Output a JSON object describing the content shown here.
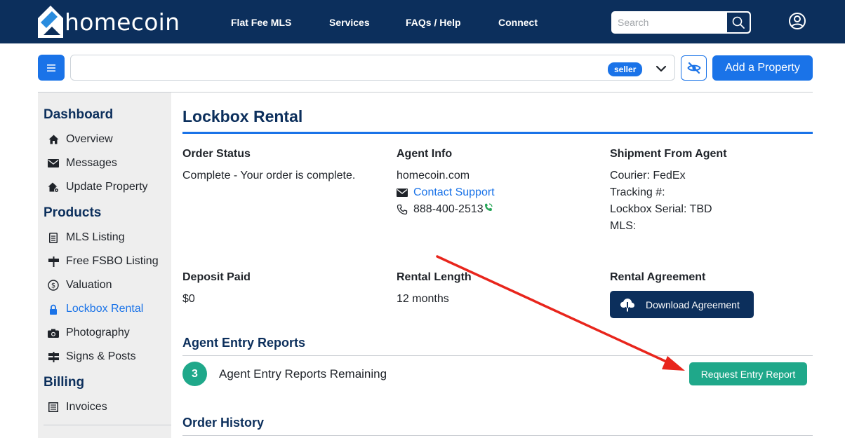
{
  "brand": {
    "name": "homecoin"
  },
  "nav": {
    "links": [
      "Flat Fee MLS",
      "Services",
      "FAQs / Help",
      "Connect"
    ],
    "search_placeholder": "Search"
  },
  "toolbar": {
    "property_value": "",
    "role_badge": "seller",
    "add_property_label": "Add a Property"
  },
  "sidebar": {
    "sections": [
      {
        "title": "Dashboard",
        "items": [
          {
            "label": "Overview",
            "icon": "home-icon"
          },
          {
            "label": "Messages",
            "icon": "envelope-icon"
          },
          {
            "label": "Update Property",
            "icon": "house-gear-icon"
          }
        ]
      },
      {
        "title": "Products",
        "items": [
          {
            "label": "MLS Listing",
            "icon": "document-icon"
          },
          {
            "label": "Free FSBO Listing",
            "icon": "signpost-icon"
          },
          {
            "label": "Valuation",
            "icon": "dollar-circle-icon"
          },
          {
            "label": "Lockbox Rental",
            "icon": "lock-icon",
            "active": true
          },
          {
            "label": "Photography",
            "icon": "camera-icon"
          },
          {
            "label": "Signs & Posts",
            "icon": "signs-icon"
          }
        ]
      },
      {
        "title": "Billing",
        "items": [
          {
            "label": "Invoices",
            "icon": "invoice-icon"
          }
        ]
      }
    ]
  },
  "main": {
    "title": "Lockbox Rental",
    "order_status": {
      "heading": "Order Status",
      "value": "Complete - Your order is complete."
    },
    "agent_info": {
      "heading": "Agent Info",
      "company": "homecoin.com",
      "contact_label": "Contact Support",
      "phone": "888-400-2513"
    },
    "shipment": {
      "heading": "Shipment From Agent",
      "courier": "Courier: FedEx",
      "tracking": "Tracking #:",
      "serial": "Lockbox Serial: TBD",
      "mls": "MLS:"
    },
    "deposit": {
      "heading": "Deposit Paid",
      "value": "$0"
    },
    "rental_length": {
      "heading": "Rental Length",
      "value": "12 months"
    },
    "rental_agreement": {
      "heading": "Rental Agreement",
      "button": "Download Agreement"
    },
    "entry_reports": {
      "heading": "Agent Entry Reports",
      "remaining_count": "3",
      "remaining_text": "Agent Entry Reports Remaining",
      "request_button": "Request Entry Report"
    },
    "order_history": {
      "heading": "Order History"
    }
  },
  "colors": {
    "navy": "#0c2f5c",
    "accent_blue": "#1a73e8",
    "teal": "#1fa88a",
    "annotation_red": "#e8251c"
  }
}
